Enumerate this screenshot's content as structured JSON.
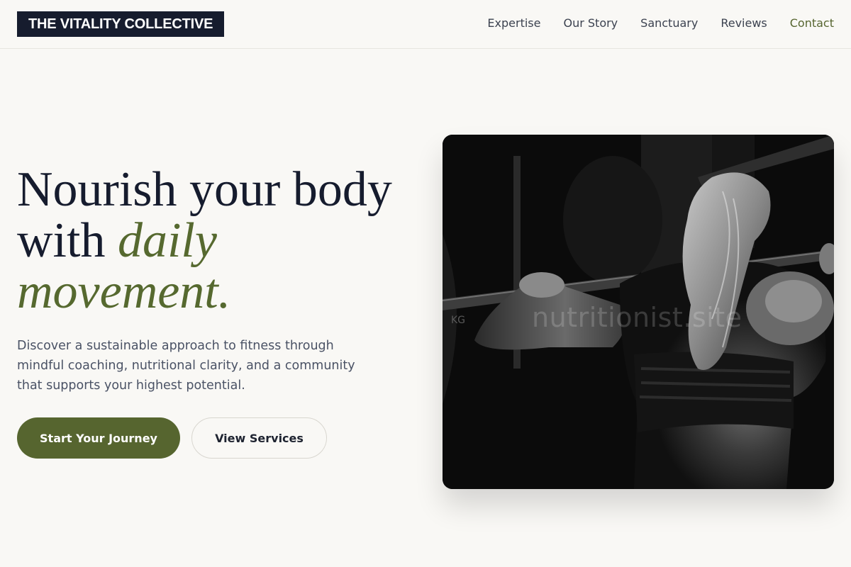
{
  "brand": {
    "name": "THE VITALITY COLLECTIVE"
  },
  "nav": {
    "items": [
      {
        "label": "Expertise"
      },
      {
        "label": "Our Story"
      },
      {
        "label": "Sanctuary"
      },
      {
        "label": "Reviews"
      },
      {
        "label": "Contact"
      }
    ]
  },
  "hero": {
    "headline_line1": "Nourish your body",
    "headline_with": "with ",
    "headline_accent_1": "daily",
    "headline_accent_2": "movement.",
    "description": "Discover a sustainable approach to fitness through mindful coaching, nutritional clarity, and a community that supports your highest potential.",
    "primary_cta": "Start Your Journey",
    "secondary_cta": "View Services",
    "image_watermark": "nutritionist.site",
    "plate_text": "KG"
  },
  "colors": {
    "background": "#f9f8f5",
    "brand_dark": "#161c2e",
    "accent_olive": "#56652f",
    "nav_active": "#56652f"
  }
}
